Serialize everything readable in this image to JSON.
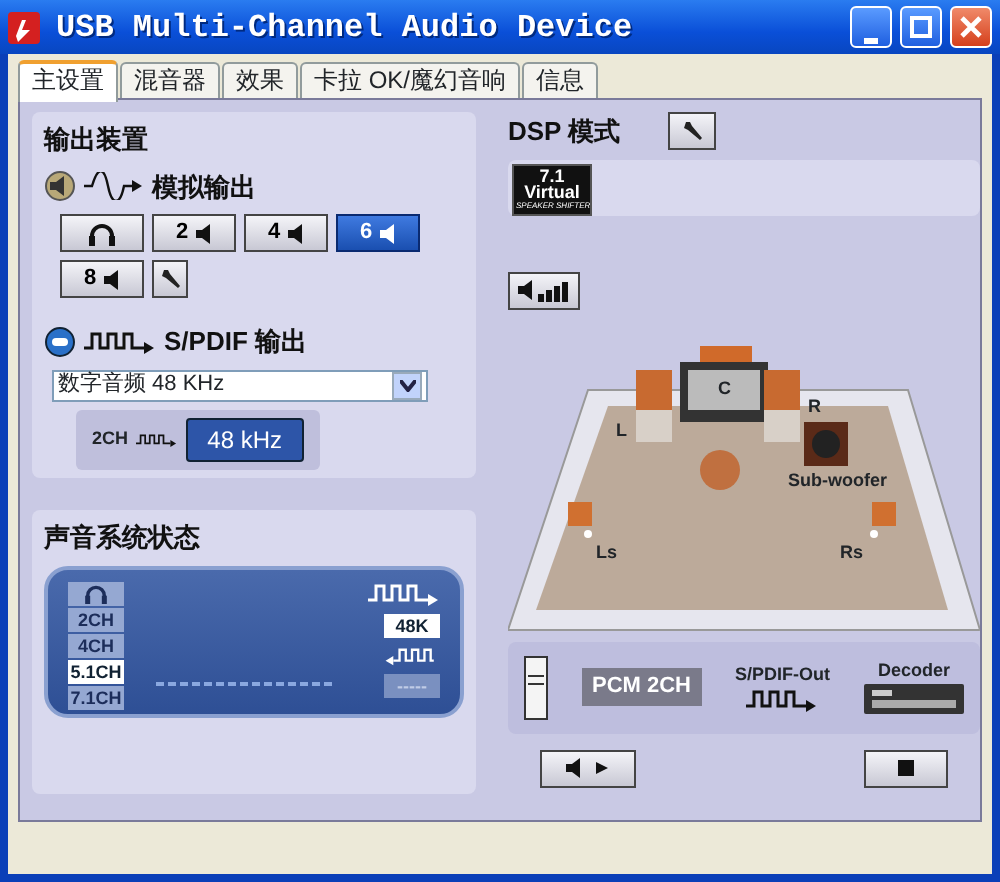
{
  "window": {
    "title": "USB Multi-Channel Audio Device"
  },
  "tabs": [
    {
      "label": "主设置",
      "selected": true
    },
    {
      "label": "混音器",
      "selected": false
    },
    {
      "label": "效果",
      "selected": false
    },
    {
      "label": "卡拉 OK/魔幻音响",
      "selected": false
    },
    {
      "label": "信息",
      "selected": false
    }
  ],
  "output_device": {
    "title": "输出装置",
    "analog_label": "模拟输出",
    "speaker_buttons": [
      {
        "kind": "headphone",
        "selected": false
      },
      {
        "kind": "channels",
        "label": "2",
        "selected": false
      },
      {
        "kind": "channels",
        "label": "4",
        "selected": false
      },
      {
        "kind": "channels",
        "label": "6",
        "selected": true
      },
      {
        "kind": "channels",
        "label": "8",
        "selected": false
      }
    ],
    "spdif_label": "S/PDIF 输出",
    "spdif_select": "数字音频 48 KHz",
    "spdif_source": "2CH",
    "spdif_rate": "48 kHz"
  },
  "sound_status": {
    "title": "声音系统状态",
    "channels": [
      {
        "kind": "headphone",
        "selected": false
      },
      {
        "kind": "text",
        "label": "2CH",
        "selected": false
      },
      {
        "kind": "text",
        "label": "4CH",
        "selected": false
      },
      {
        "kind": "text",
        "label": "5.1CH",
        "selected": true
      },
      {
        "kind": "text",
        "label": "7.1CH",
        "selected": false
      }
    ],
    "output_rate": "48K",
    "input_rate": "-----"
  },
  "dsp": {
    "title": "DSP 模式",
    "logo": {
      "line_1": "7.1",
      "line_2": "Virtual",
      "line_3": "SPEAKER SHIFTER"
    },
    "speakers": [
      {
        "label": "C"
      },
      {
        "label": "L"
      },
      {
        "label": "R"
      },
      {
        "label": "Sub-woofer"
      },
      {
        "label": "Ls"
      },
      {
        "label": "Rs"
      }
    ],
    "chain": {
      "format": "PCM 2CH",
      "link_label": "S/PDIF-Out",
      "target_label": "Decoder"
    }
  }
}
